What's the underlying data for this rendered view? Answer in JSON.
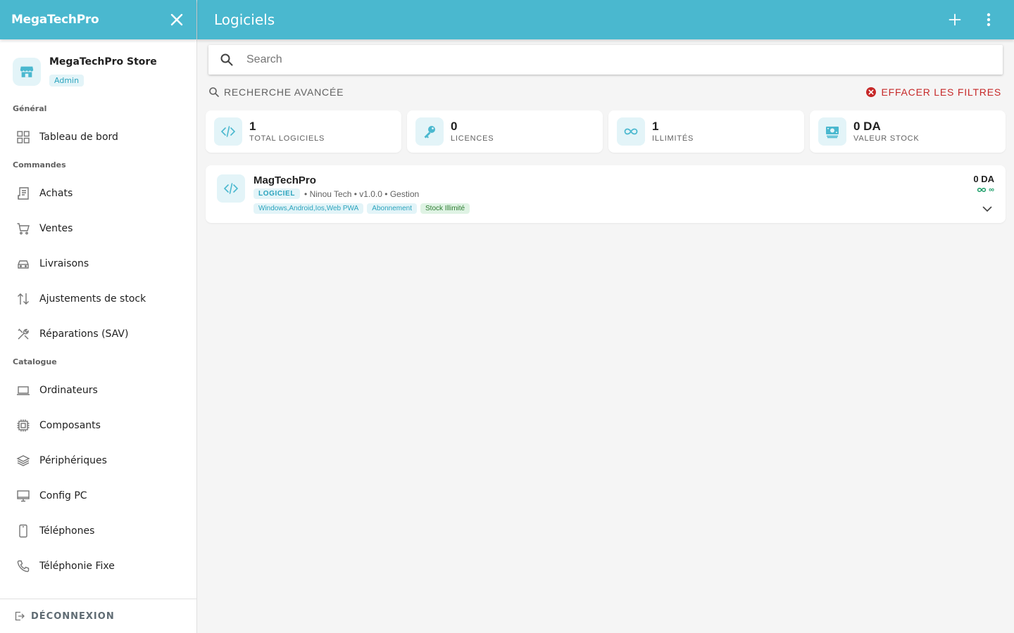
{
  "sidebar": {
    "brand": "MegaTechPro",
    "store": {
      "name": "MegaTechPro Store",
      "role": "Admin"
    },
    "sections": [
      {
        "title": "Général",
        "items": [
          {
            "label": "Tableau de bord",
            "icon": "dashboard-icon"
          }
        ]
      },
      {
        "title": "Commandes",
        "items": [
          {
            "label": "Achats",
            "icon": "receipt-icon"
          },
          {
            "label": "Ventes",
            "icon": "cart-icon"
          },
          {
            "label": "Livraisons",
            "icon": "car-icon"
          },
          {
            "label": "Ajustements de stock",
            "icon": "swap-vertical-icon"
          },
          {
            "label": "Réparations (SAV)",
            "icon": "tools-icon"
          }
        ]
      },
      {
        "title": "Catalogue",
        "items": [
          {
            "label": "Ordinateurs",
            "icon": "laptop-icon"
          },
          {
            "label": "Composants",
            "icon": "chip-icon"
          },
          {
            "label": "Périphériques",
            "icon": "layers-icon"
          },
          {
            "label": "Config PC",
            "icon": "monitor-icon"
          },
          {
            "label": "Téléphones",
            "icon": "phone-icon"
          },
          {
            "label": "Téléphonie Fixe",
            "icon": "landline-icon"
          }
        ]
      }
    ],
    "logout": "DÉCONNEXION"
  },
  "header": {
    "title": "Logiciels"
  },
  "search": {
    "placeholder": "Search",
    "value": ""
  },
  "filters": {
    "advanced": "RECHERCHE AVANCÉE",
    "clear": "EFFACER LES FILTRES"
  },
  "stats": [
    {
      "value": "1",
      "label": "TOTAL LOGICIELS",
      "icon": "code-icon"
    },
    {
      "value": "0",
      "label": "LICENCES",
      "icon": "key-icon"
    },
    {
      "value": "1",
      "label": "ILLIMITÉS",
      "icon": "infinity-icon"
    },
    {
      "value": "0 DA",
      "label": "VALEUR STOCK",
      "icon": "money-icon"
    }
  ],
  "products": [
    {
      "name": "MagTechPro",
      "type": "LOGICIEL",
      "meta": "• Ninou Tech • v1.0.0 • Gestion",
      "tags": [
        "Windows,Android,Ios,Web PWA",
        "Abonnement",
        "Stock Illimité"
      ],
      "price": "0 DA",
      "stock": "∞"
    }
  ],
  "colors": {
    "primary": "#4ab8cf",
    "accent_light": "#e3f4f8",
    "danger": "#c62828",
    "success": "#1e9e6a"
  }
}
